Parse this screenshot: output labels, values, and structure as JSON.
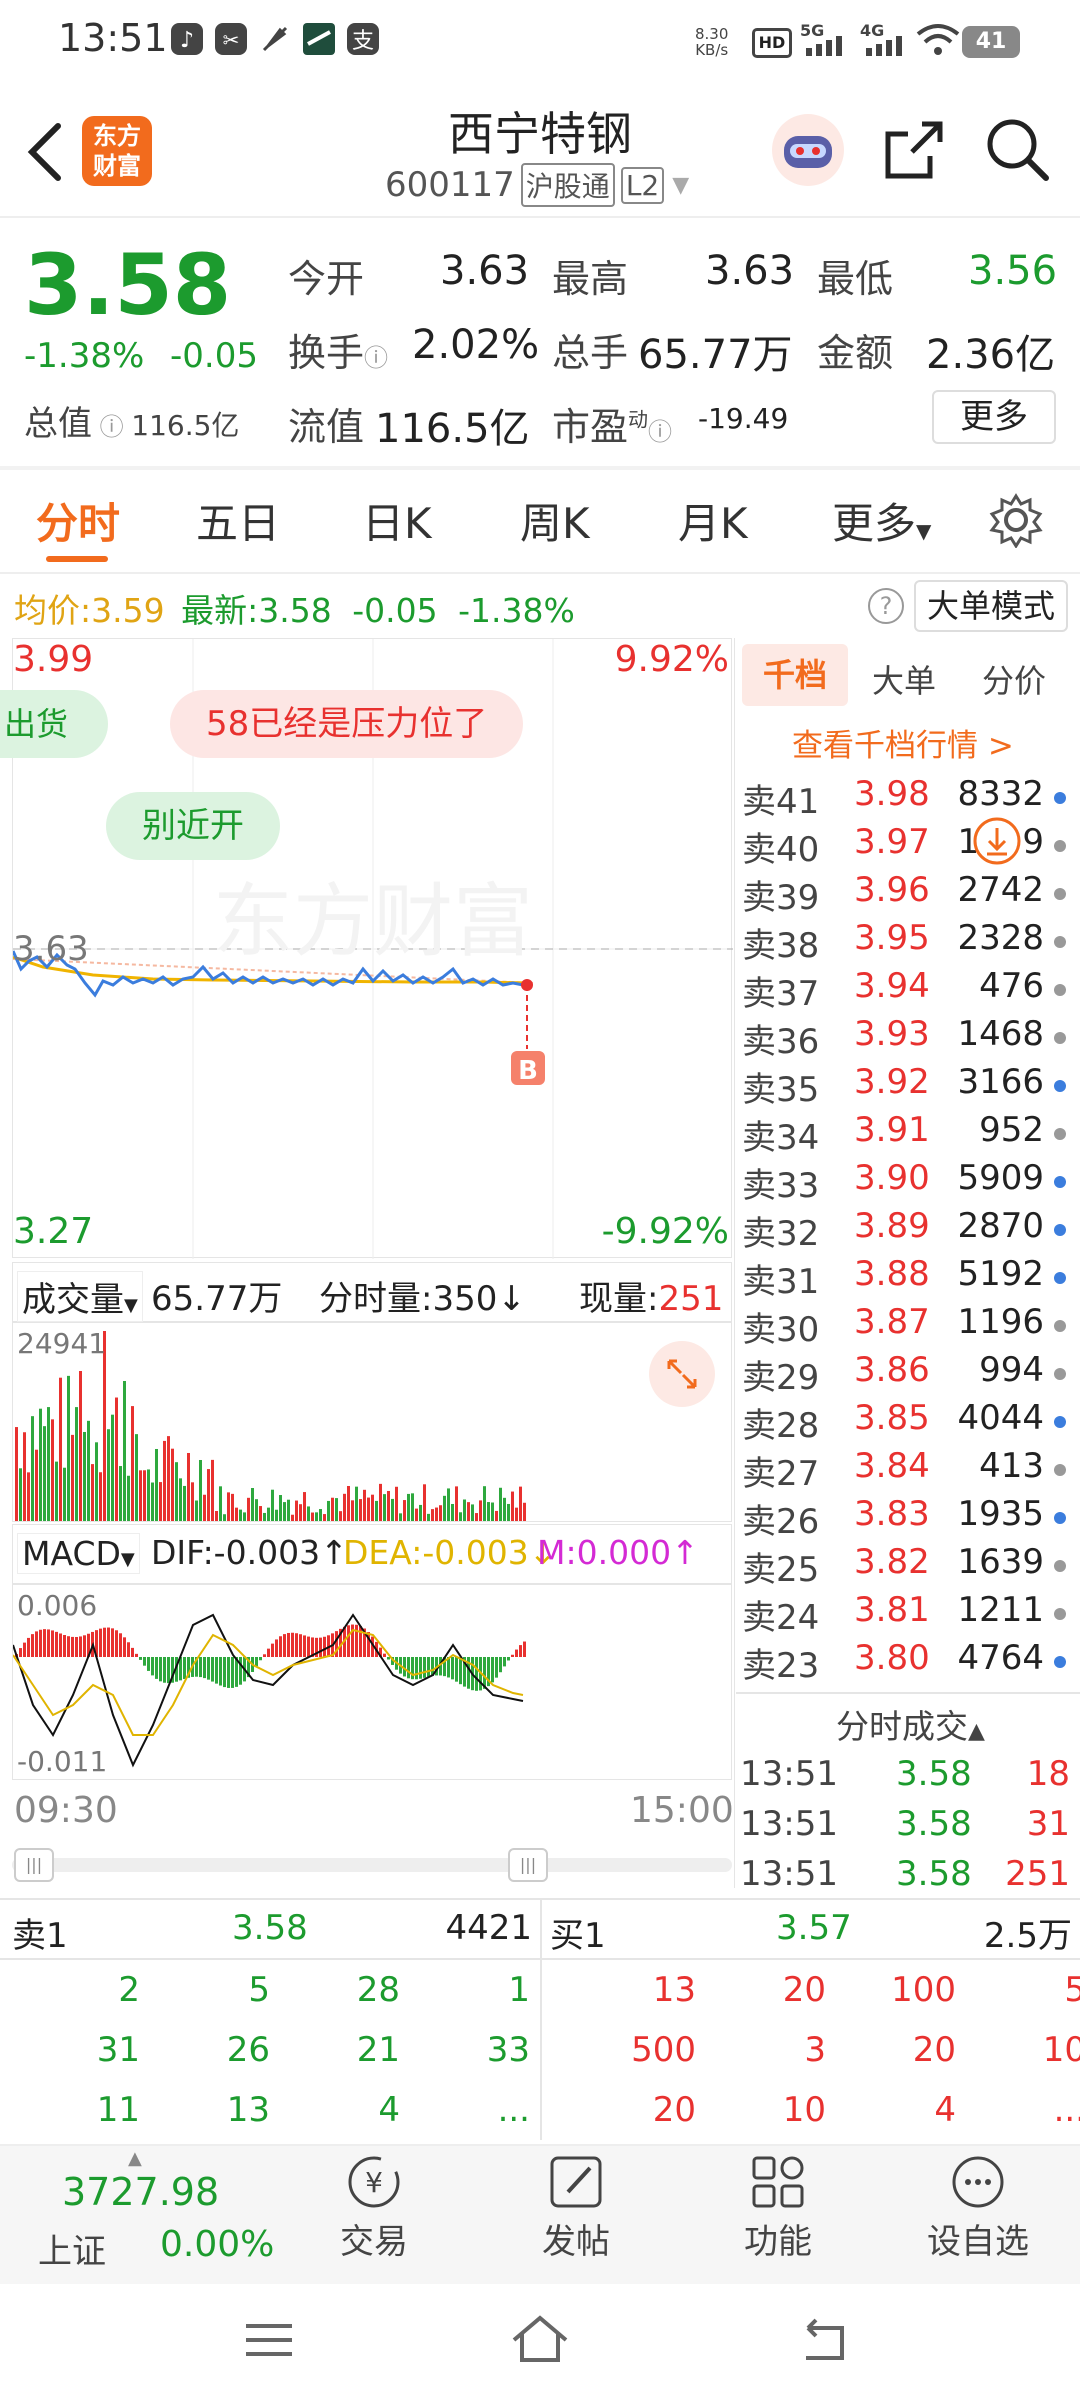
{
  "status_bar": {
    "time": "13:51",
    "net_speed": "8.30",
    "net_unit": "KB/s",
    "signal1": "5G",
    "signal2": "4G",
    "battery": "41"
  },
  "header": {
    "title": "西宁特钢",
    "code": "600117",
    "market": "沪股通",
    "level": "L2",
    "logo_line1": "东方",
    "logo_line2": "财富"
  },
  "quote": {
    "price": "3.58",
    "change_pct": "-1.38%",
    "change": "-0.05",
    "open_label": "今开",
    "open": "3.63",
    "high_label": "最高",
    "high": "3.63",
    "low_label": "最低",
    "low": "3.56",
    "turnover_label": "换手",
    "turnover": "2.02%",
    "volume_label": "总手",
    "volume": "65.77万",
    "amount_label": "金额",
    "amount": "2.36亿",
    "mktcap_label": "总值",
    "mktcap": "116.5亿",
    "float_label": "流值",
    "float": "116.5亿",
    "pe_label": "市盈",
    "pe_sup": "动",
    "pe": "-19.49",
    "more_btn": "更多"
  },
  "tabs": [
    "分时",
    "五日",
    "日K",
    "周K",
    "月K",
    "更多"
  ],
  "info_bar": {
    "avg_label": "均价:",
    "avg": "3.59",
    "last_label": "最新:",
    "last": "3.58",
    "chg": "-0.05",
    "chg_pct": "-1.38%",
    "mode_btn": "大单模式",
    "help": "?"
  },
  "chart": {
    "max": "3.99",
    "max_pct": "9.92%",
    "min": "3.27",
    "min_pct": "-9.92%",
    "prev_close": "3.63",
    "bubble1": "出货",
    "bubble2": "58已经是压力位了",
    "bubble3": "别近开",
    "marker": "B",
    "watermark": "东方财富",
    "time_start": "09:30",
    "time_end": "15:00"
  },
  "volume": {
    "selector": "成交量",
    "total": "65.77万",
    "tick_label": "分时量:350",
    "now_label": "现量:",
    "now": "251",
    "max": "24941"
  },
  "macd": {
    "selector": "MACD",
    "dif": "DIF:-0.003",
    "dea": "DEA:-0.003",
    "m": "M:0.000",
    "top": "0.006",
    "bottom": "-0.011"
  },
  "side_tabs": [
    "千档",
    "大单",
    "分价"
  ],
  "side_link": "查看千档行情 >",
  "order_book": [
    {
      "l": "卖41",
      "p": "3.98",
      "v": "8332",
      "dot": "#3b7ddd"
    },
    {
      "l": "卖40",
      "p": "3.97",
      "v": "1699",
      "dot": "#999"
    },
    {
      "l": "卖39",
      "p": "3.96",
      "v": "2742",
      "dot": "#999"
    },
    {
      "l": "卖38",
      "p": "3.95",
      "v": "2328",
      "dot": "#999"
    },
    {
      "l": "卖37",
      "p": "3.94",
      "v": "476",
      "dot": "#999"
    },
    {
      "l": "卖36",
      "p": "3.93",
      "v": "1468",
      "dot": "#999"
    },
    {
      "l": "卖35",
      "p": "3.92",
      "v": "3166",
      "dot": "#3b7ddd"
    },
    {
      "l": "卖34",
      "p": "3.91",
      "v": "952",
      "dot": "#999"
    },
    {
      "l": "卖33",
      "p": "3.90",
      "v": "5909",
      "dot": "#3b7ddd"
    },
    {
      "l": "卖32",
      "p": "3.89",
      "v": "2870",
      "dot": "#3b7ddd"
    },
    {
      "l": "卖31",
      "p": "3.88",
      "v": "5192",
      "dot": "#3b7ddd"
    },
    {
      "l": "卖30",
      "p": "3.87",
      "v": "1196",
      "dot": "#999"
    },
    {
      "l": "卖29",
      "p": "3.86",
      "v": "994",
      "dot": "#999"
    },
    {
      "l": "卖28",
      "p": "3.85",
      "v": "4044",
      "dot": "#3b7ddd"
    },
    {
      "l": "卖27",
      "p": "3.84",
      "v": "413",
      "dot": "#999"
    },
    {
      "l": "卖26",
      "p": "3.83",
      "v": "1935",
      "dot": "#3b7ddd"
    },
    {
      "l": "卖25",
      "p": "3.82",
      "v": "1639",
      "dot": "#999"
    },
    {
      "l": "卖24",
      "p": "3.81",
      "v": "1211",
      "dot": "#999"
    },
    {
      "l": "卖23",
      "p": "3.80",
      "v": "4764",
      "dot": "#3b7ddd"
    }
  ],
  "trades_title": "分时成交",
  "trades": [
    {
      "t": "13:51",
      "p": "3.58",
      "v": "18"
    },
    {
      "t": "13:51",
      "p": "3.58",
      "v": "31"
    },
    {
      "t": "13:51",
      "p": "3.58",
      "v": "251"
    }
  ],
  "sell1": {
    "label": "卖1",
    "price": "3.58",
    "vol": "4421",
    "rows": [
      [
        "2",
        "5",
        "28",
        "1"
      ],
      [
        "31",
        "26",
        "21",
        "33"
      ],
      [
        "11",
        "13",
        "4",
        "..."
      ]
    ]
  },
  "buy1": {
    "label": "买1",
    "price": "3.57",
    "vol": "2.5万",
    "rows": [
      [
        "13",
        "20",
        "100",
        "5"
      ],
      [
        "500",
        "3",
        "20",
        "10"
      ],
      [
        "20",
        "10",
        "4",
        "..."
      ]
    ]
  },
  "bottom_nav": {
    "index_value": "3727.98",
    "index_name": "上证",
    "index_pct": "0.00%",
    "items": [
      "交易",
      "发帖",
      "功能",
      "设自选"
    ]
  },
  "colors": {
    "up": "#e8312f",
    "down": "#1c9b2e",
    "accent": "#f26b1d"
  }
}
